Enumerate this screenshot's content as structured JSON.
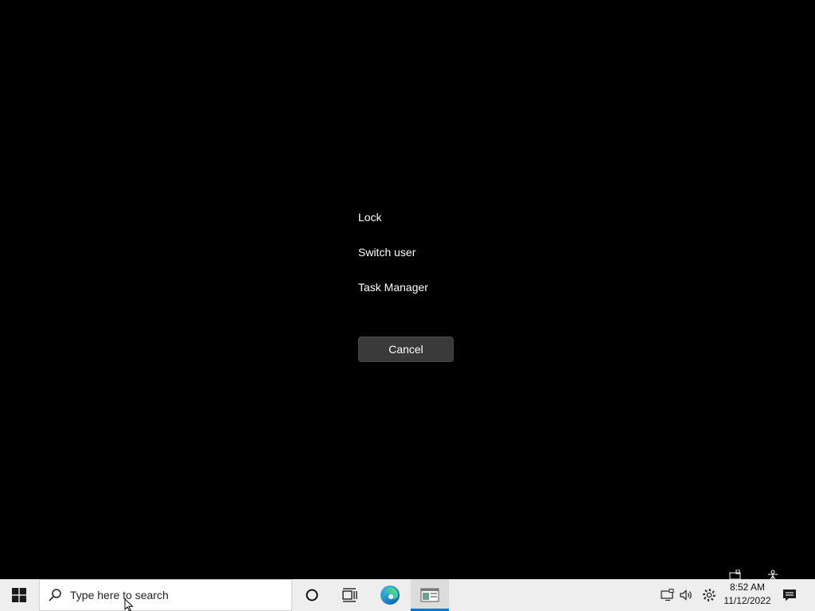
{
  "security_screen": {
    "options": [
      {
        "id": "lock",
        "label": "Lock"
      },
      {
        "id": "switch-user",
        "label": "Switch user"
      },
      {
        "id": "task-manager",
        "label": "Task Manager"
      }
    ],
    "cancel_label": "Cancel"
  },
  "taskbar": {
    "start_icon": "windows-logo-icon",
    "search": {
      "placeholder": "Type here to search",
      "icon": "search-icon"
    },
    "pinned": [
      {
        "name": "cortana",
        "icon": "cortana-circle-icon"
      },
      {
        "name": "task-view",
        "icon": "task-view-icon"
      },
      {
        "name": "edge",
        "icon": "edge-icon"
      },
      {
        "name": "active-app",
        "icon": "window-app-icon",
        "active": true
      }
    ],
    "tray": {
      "icons": [
        "network-icon",
        "volume-icon",
        "settings-icon"
      ],
      "time": "8:52 AM",
      "date": "11/12/2022",
      "notification_icon": "notification-icon"
    },
    "colors": {
      "background": "#eeeeee",
      "accent": "#0078d7"
    }
  },
  "colors": {
    "screen_background": "#000000",
    "button_background": "#3a3a3a",
    "text": "#ffffff"
  }
}
